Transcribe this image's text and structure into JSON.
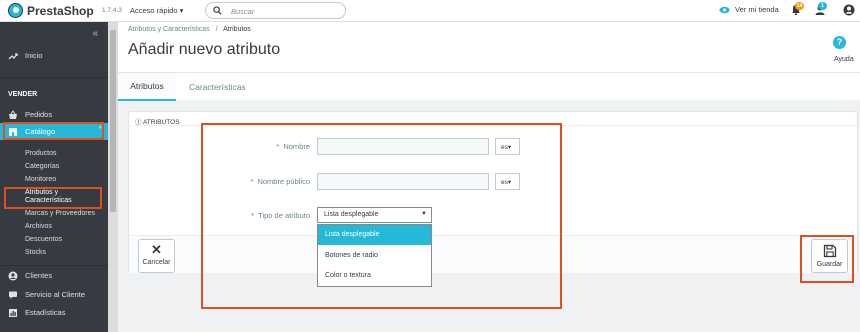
{
  "header": {
    "brand": "PrestaShop",
    "version": "1.7.4.3",
    "quick_access": "Acceso rápido",
    "quick_access_arrow": "▾",
    "search_placeholder": "Buscar",
    "view_shop": "Ver mi tienda",
    "badge_orders": "14",
    "badge_customers": "1"
  },
  "sidebar": {
    "collapse": "«",
    "home": "Inicio",
    "section_sell": "VENDER",
    "orders": "Pedidos",
    "catalog": "Catálogo",
    "catalog_sub": [
      "Productos",
      "Categorías",
      "Monitoreo",
      "Atributos y Características",
      "Marcas y Proveedores",
      "Archivos",
      "Descuentos",
      "Stocks"
    ],
    "customers": "Clientes",
    "customer_service": "Servicio al Cliente",
    "stats": "Estadísticas"
  },
  "page": {
    "breadcrumb_parent": "Atributos y Características",
    "breadcrumb_sep": "/",
    "breadcrumb_current": "Atributos",
    "title": "Añadir nuevo atributo",
    "help": "Ayuda",
    "help_glyph": "?"
  },
  "tabs": [
    "Atributos",
    "Características"
  ],
  "form": {
    "panel_title": "ATRIBUTOS",
    "required_mark": "*",
    "name_label": "Nombre",
    "public_name_label": "Nombre público",
    "type_label": "Tipo de atributo",
    "lang": "es",
    "lang_arrow": "▾",
    "type_selected": "Lista desplegable",
    "type_arrow": "▼",
    "type_options": [
      "Lista desplegable",
      "Botones de radio",
      "Color o textura"
    ]
  },
  "actions": {
    "cancel": "Cancelar",
    "cancel_glyph": "✕",
    "save": "Guardar"
  },
  "colors": {
    "accent": "#25b9d7",
    "sidebar": "#363a41",
    "highlight": "#e0501f",
    "required": "#c05c67"
  }
}
